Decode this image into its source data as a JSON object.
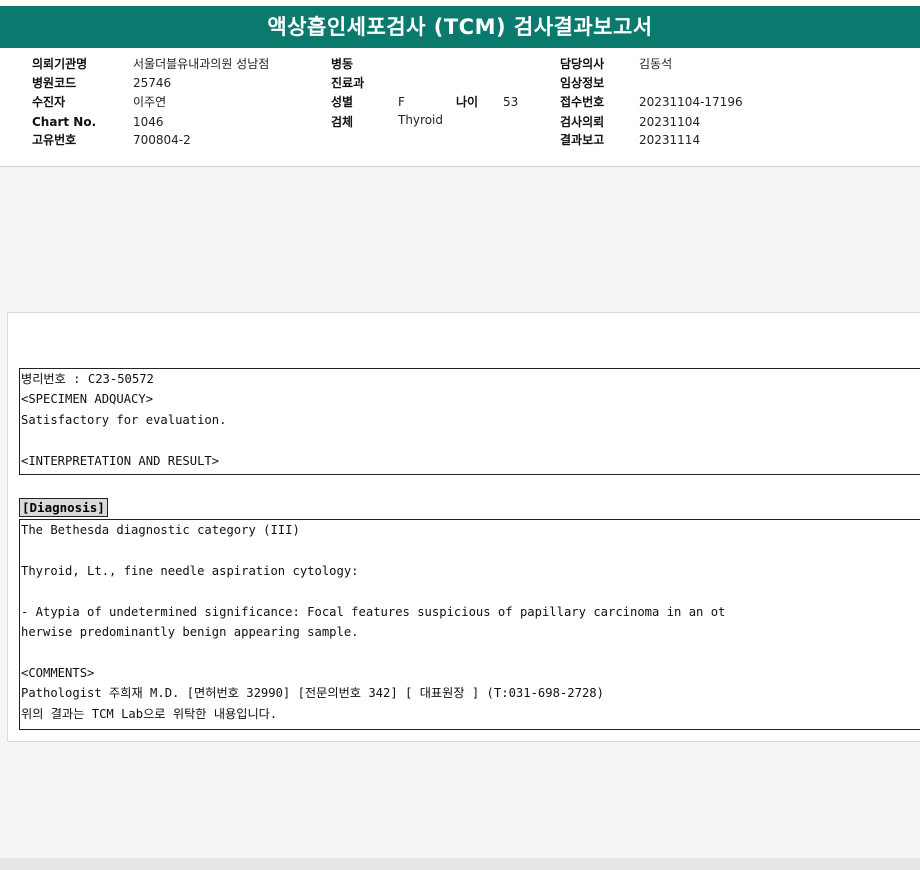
{
  "report": {
    "title": "액상흡인세포검사 (TCM) 검사결과보고서"
  },
  "header": {
    "institution_label": "의뢰기관명",
    "institution": "서울더블유내과의원 성남점",
    "hospital_code_label": "병원코드",
    "hospital_code": "25746",
    "patient_label": "수진자",
    "patient": "이주연",
    "chart_label": "Chart No.",
    "chart": "1046",
    "unique_label": "고유번호",
    "unique": "700804-2",
    "ward_label": "병동",
    "ward": "",
    "dept_label": "진료과",
    "dept": "",
    "sex_label": "성별",
    "sex": "F",
    "age_label": "나이",
    "age": "53",
    "specimen_label": "검체",
    "specimen": "Thyroid",
    "doctor_label": "담당의사",
    "doctor": "김동석",
    "clinical_label": "임상정보",
    "clinical": "",
    "receipt_label": "접수번호",
    "receipt": "20231104-17196",
    "request_label": "검사의뢰",
    "request": "20231104",
    "result_label": "결과보고",
    "result": "20231114"
  },
  "body": {
    "pathology_no": "병리번호 : C23-50572",
    "specimen_adequacy_head": "<SPECIMEN ADQUACY>",
    "specimen_adequacy": "Satisfactory for evaluation.",
    "interpretation_head": "<INTERPRETATION AND RESULT>",
    "diagnosis_label": "[Diagnosis]",
    "bethesda": "The Bethesda diagnostic category (III)",
    "site": "Thyroid, Lt., fine needle aspiration cytology:",
    "finding_line1": "- Atypia of undetermined significance: Focal features suspicious of papillary carcinoma in an ot",
    "finding_line2": "herwise predominantly benign appearing sample.",
    "comments_head": "<COMMENTS>",
    "pathologist": "Pathologist 주희재 M.D. [면허번호 32990] [전문의번호 342] [ 대표원장 ] (T:031-698-2728)",
    "note": "위의 결과는 TCM Lab으로 위탁한 내용입니다."
  },
  "colors": {
    "title_bar": "#0b7a6e",
    "title_text": "#ffffff"
  }
}
